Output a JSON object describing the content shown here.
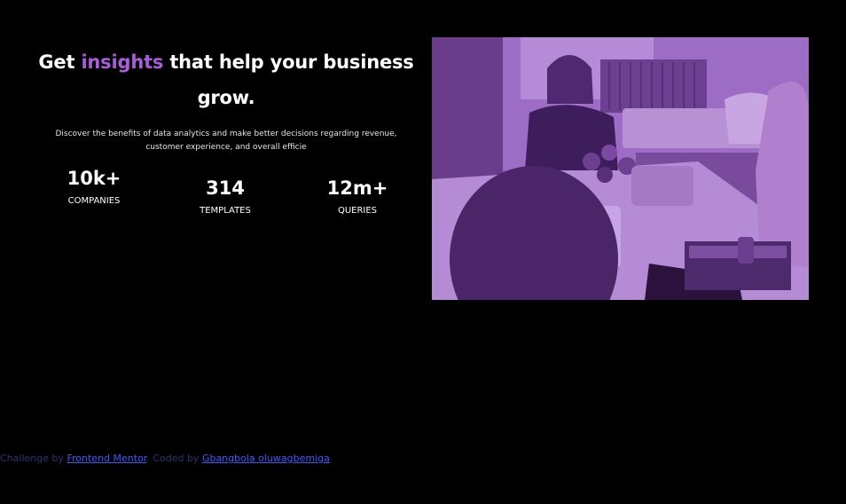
{
  "hero": {
    "headline_before": "Get",
    "headline_accent": "insights",
    "headline_after": "that help your business grow.",
    "description": "Discover the benefits of data analytics and make better decisions regarding revenue, customer experience, and overall efficie",
    "accent_color": "#aa5cdb"
  },
  "stats": [
    {
      "value": "10k+",
      "label": "COMPANIES"
    },
    {
      "value": "314",
      "label": "TEMPLATES"
    },
    {
      "value": "12m+",
      "label": "QUERIES"
    }
  ],
  "image": {
    "overlay_color": "#8c5ab3"
  },
  "footer": {
    "challenge_prefix": "Challenge by",
    "challenge_link": "Frontend Mentor",
    "coded_prefix": ". Coded by",
    "coded_link": "Gbangbola oluwagbemiga"
  }
}
